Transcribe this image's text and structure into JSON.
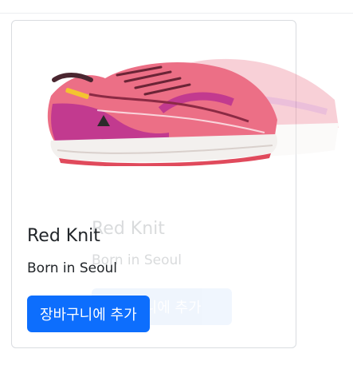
{
  "product": {
    "name": "Red Knit",
    "origin": "Born in Seoul",
    "add_to_cart_label": "장바구니에 추가",
    "image_icon": "running-shoe-icon",
    "shoe_colors": {
      "upper": "#ec6f86",
      "midsole": "#f3f0ee",
      "accent": "#c23a8f",
      "laces": "#8b2a44"
    }
  },
  "theme": {
    "primary": "#0d6efd",
    "border": "#d9dce0"
  }
}
